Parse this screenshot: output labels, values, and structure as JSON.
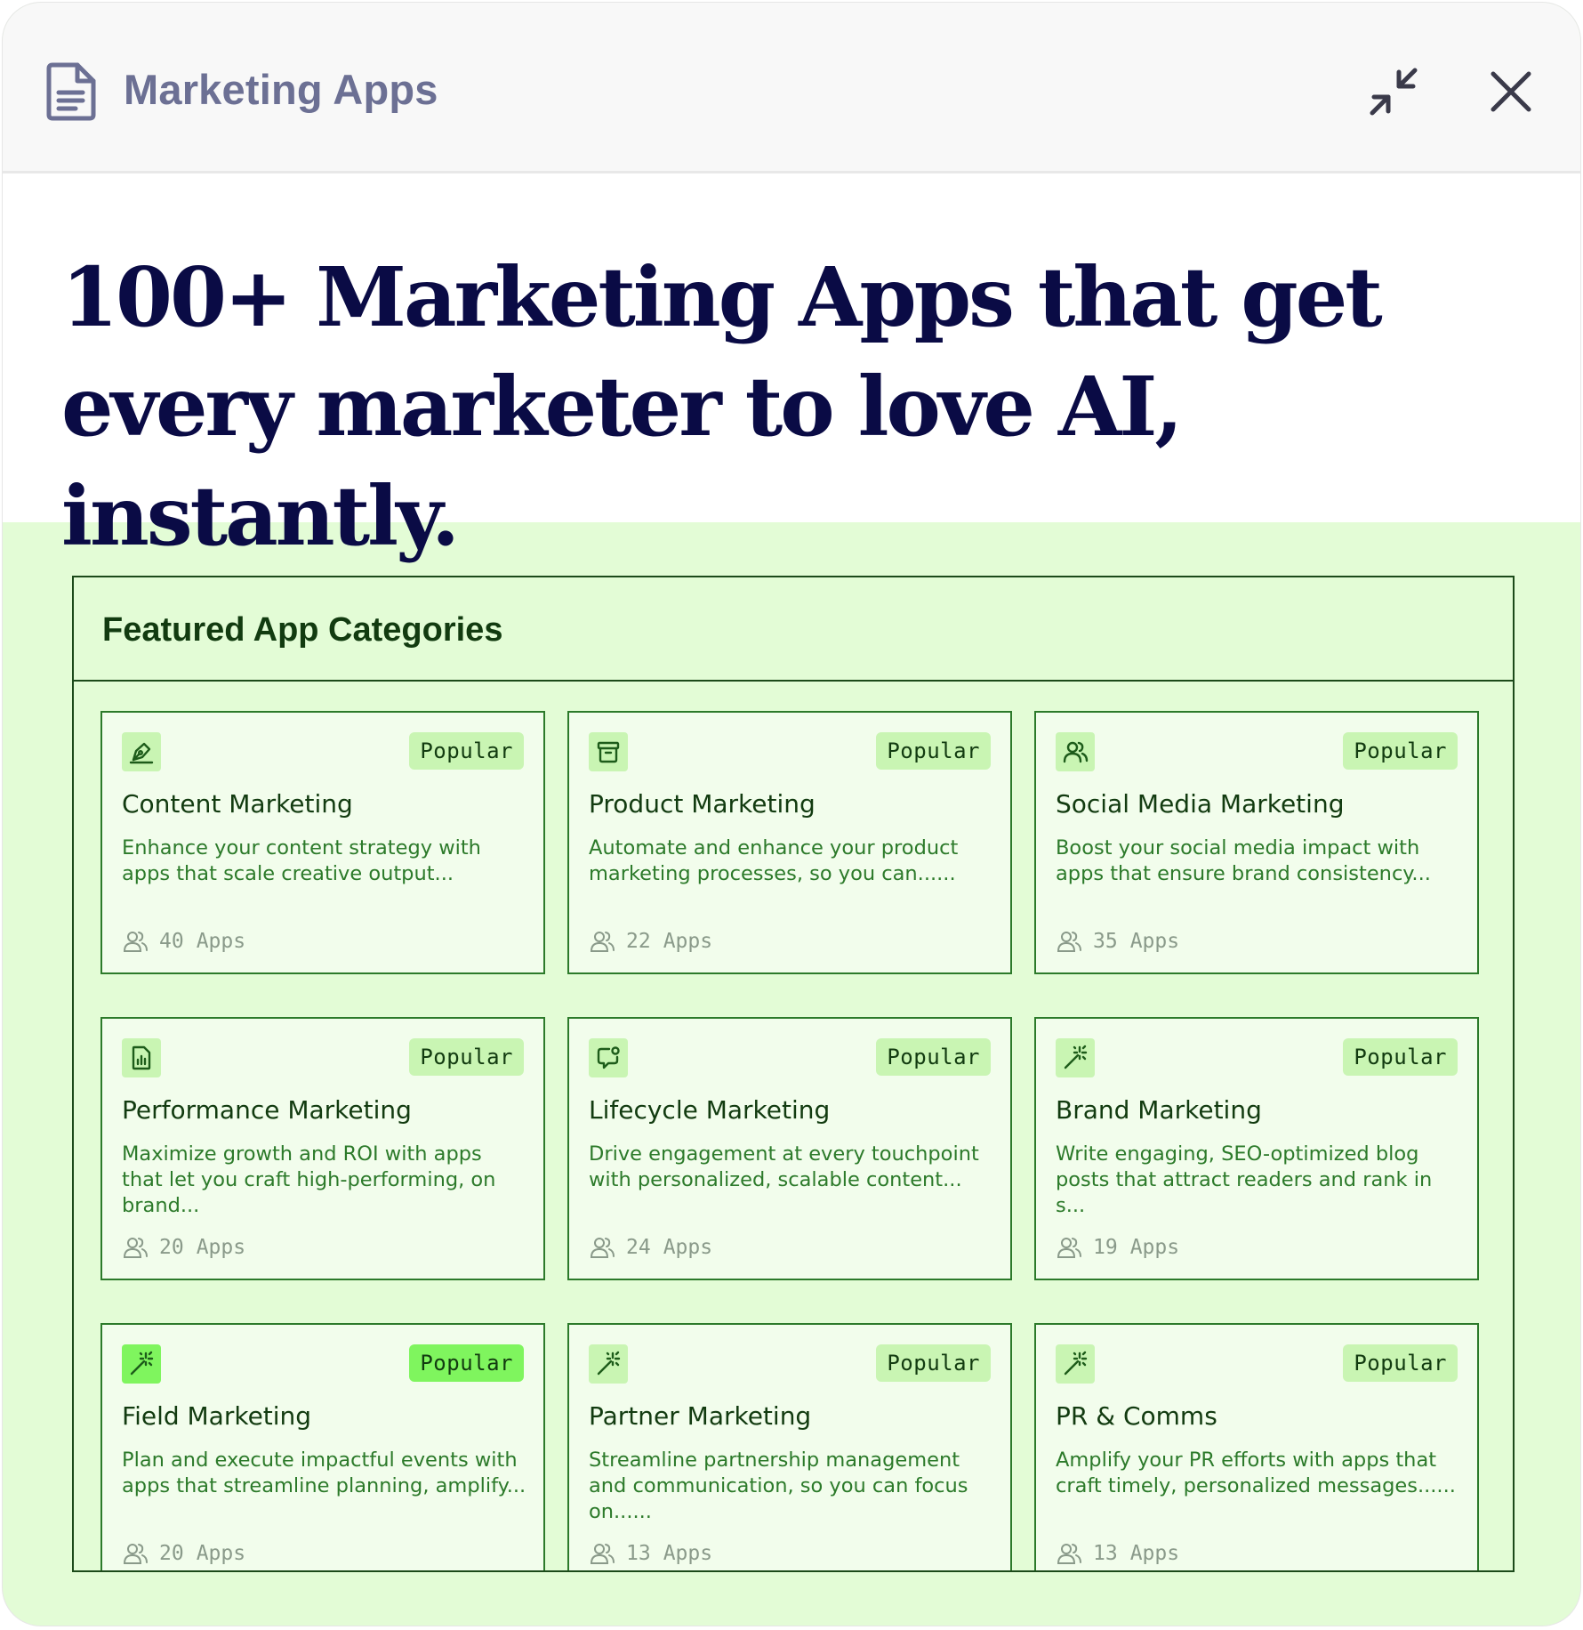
{
  "window": {
    "title": "Marketing Apps"
  },
  "hero": {
    "headline": "100+ Marketing Apps that get every marketer to love AI, instantly."
  },
  "panel": {
    "title": "Featured App Categories",
    "apps_unit": "Apps",
    "cards": [
      {
        "icon": "pen-tool-icon",
        "badge": "Popular",
        "title": "Content Marketing",
        "description": "Enhance your content strategy with apps that scale creative output...",
        "count": "40"
      },
      {
        "icon": "archive-box-icon",
        "badge": "Popular",
        "title": "Product Marketing",
        "description": "Automate and enhance your product marketing processes, so you can......",
        "count": "22"
      },
      {
        "icon": "users-icon",
        "badge": "Popular",
        "title": "Social Media Marketing",
        "description": "Boost your social media impact with apps that ensure brand consistency...",
        "count": "35"
      },
      {
        "icon": "bar-chart-file-icon",
        "badge": "Popular",
        "title": "Performance Marketing",
        "description": "Maximize growth and ROI with apps that let you craft high-performing, on brand...",
        "count": "20"
      },
      {
        "icon": "chat-bubble-icon",
        "badge": "Popular",
        "title": "Lifecycle Marketing",
        "description": "Drive engagement at every touchpoint with personalized, scalable content...",
        "count": "24"
      },
      {
        "icon": "magic-wand-icon",
        "badge": "Popular",
        "title": "Brand Marketing",
        "description": "Write engaging, SEO-optimized blog posts that attract readers and rank in s...",
        "count": "19"
      },
      {
        "icon": "magic-wand-icon",
        "badge": "Popular",
        "title": "Field Marketing",
        "description": "Plan and execute impactful events with apps that streamline planning, amplify...",
        "count": "20",
        "highlighted": true
      },
      {
        "icon": "magic-wand-icon",
        "badge": "Popular",
        "title": "Partner Marketing",
        "description": "Streamline partnership management and communication, so you can focus on......",
        "count": "13"
      },
      {
        "icon": "magic-wand-icon",
        "badge": "Popular",
        "title": "PR & Comms",
        "description": "Amplify your PR efforts with apps that craft timely, personalized messages......",
        "count": "13"
      }
    ]
  },
  "colors": {
    "panel_background": "#e3fcd6",
    "accent_green": "#7ff55e",
    "badge_green": "#c9f5b3",
    "dark_green": "#123b10",
    "text_green": "#2c7a2a",
    "headline_navy": "#0a0b45",
    "title_gray": "#6c7094"
  }
}
